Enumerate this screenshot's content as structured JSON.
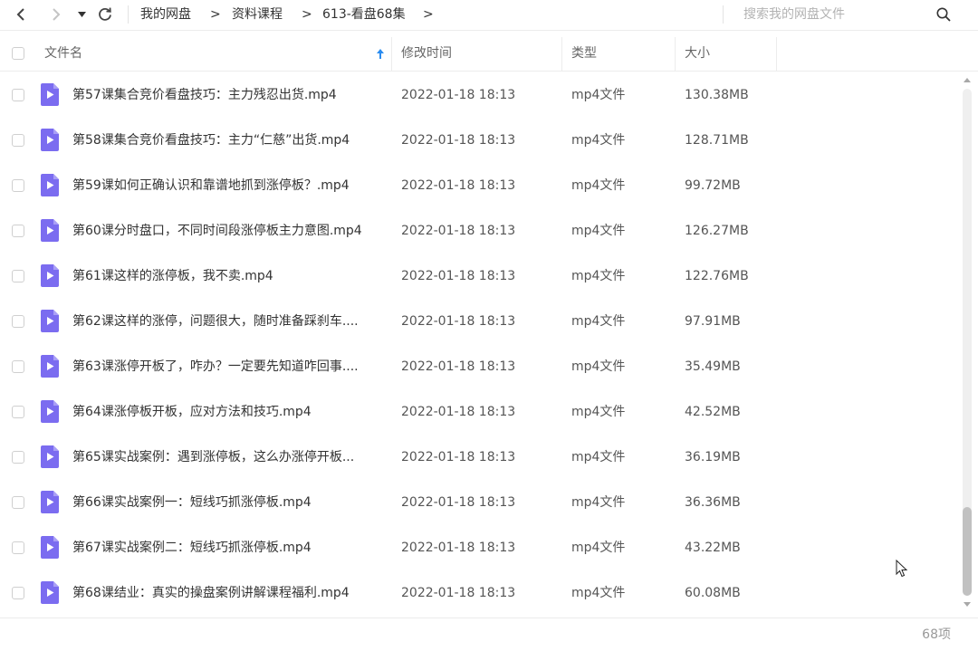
{
  "toolbar": {
    "breadcrumbs": [
      "我的网盘",
      "资料课程",
      "613-看盘68集"
    ],
    "arrow": ">",
    "search_placeholder": "搜索我的网盘文件"
  },
  "header": {
    "name": "文件名",
    "modified": "修改时间",
    "type": "类型",
    "size": "大小"
  },
  "files": [
    {
      "name": "第57课集合竞价看盘技巧：主力残忍出货.mp4",
      "date": "2022-01-18 18:13",
      "type": "mp4文件",
      "size": "130.38MB"
    },
    {
      "name": "第58课集合竞价看盘技巧：主力“仁慈”出货.mp4",
      "date": "2022-01-18 18:13",
      "type": "mp4文件",
      "size": "128.71MB"
    },
    {
      "name": "第59课如何正确认识和靠谱地抓到涨停板？.mp4",
      "date": "2022-01-18 18:13",
      "type": "mp4文件",
      "size": "99.72MB"
    },
    {
      "name": "第60课分时盘口，不同时间段涨停板主力意图.mp4",
      "date": "2022-01-18 18:13",
      "type": "mp4文件",
      "size": "126.27MB"
    },
    {
      "name": "第61课这样的涨停板，我不卖.mp4",
      "date": "2022-01-18 18:13",
      "type": "mp4文件",
      "size": "122.76MB"
    },
    {
      "name": "第62课这样的涨停，问题很大，随时准备踩刹车....",
      "date": "2022-01-18 18:13",
      "type": "mp4文件",
      "size": "97.91MB"
    },
    {
      "name": "第63课涨停开板了，咋办？一定要先知道咋回事....",
      "date": "2022-01-18 18:13",
      "type": "mp4文件",
      "size": "35.49MB"
    },
    {
      "name": "第64课涨停板开板，应对方法和技巧.mp4",
      "date": "2022-01-18 18:13",
      "type": "mp4文件",
      "size": "42.52MB"
    },
    {
      "name": "第65课实战案例：遇到涨停板，这么办涨停开板...",
      "date": "2022-01-18 18:13",
      "type": "mp4文件",
      "size": "36.19MB"
    },
    {
      "name": "第66课实战案例一：短线巧抓涨停板.mp4",
      "date": "2022-01-18 18:13",
      "type": "mp4文件",
      "size": "36.36MB"
    },
    {
      "name": "第67课实战案例二：短线巧抓涨停板.mp4",
      "date": "2022-01-18 18:13",
      "type": "mp4文件",
      "size": "43.22MB"
    },
    {
      "name": "第68课结业：真实的操盘案例讲解课程福利.mp4",
      "date": "2022-01-18 18:13",
      "type": "mp4文件",
      "size": "60.08MB"
    }
  ],
  "footer": {
    "count": "68项"
  },
  "colors": {
    "video_icon": "#7b6cf0",
    "sort_arrow": "#2a8cf0"
  }
}
